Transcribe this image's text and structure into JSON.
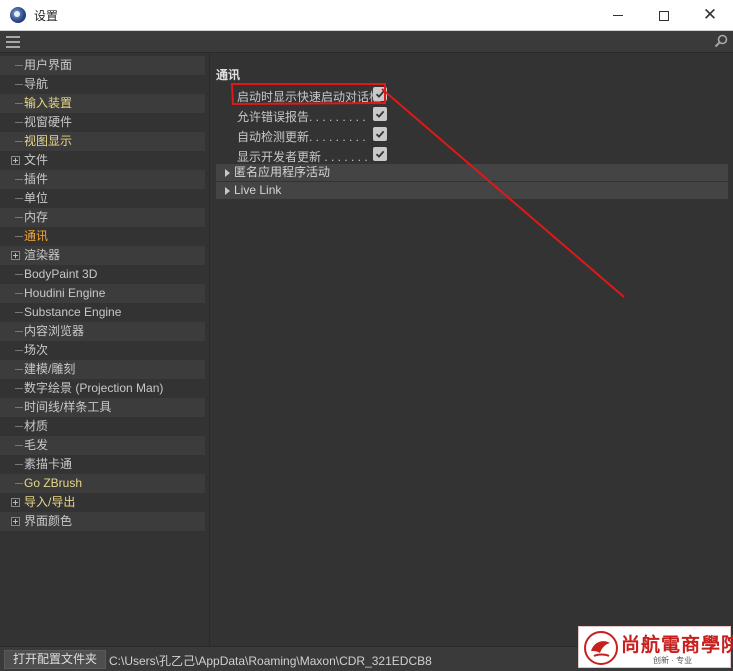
{
  "window": {
    "title": "设置",
    "minimize_icon": "minimize-icon",
    "maximize_icon": "maximize-icon",
    "close_icon": "close-icon"
  },
  "toolbar": {
    "menu_icon": "hamburger-menu-icon",
    "search_icon": "search-icon"
  },
  "sidebar": {
    "items": [
      {
        "label": "用户界面",
        "expandable": false,
        "style": "normal"
      },
      {
        "label": "导航",
        "expandable": false,
        "style": "normal"
      },
      {
        "label": "输入装置",
        "expandable": false,
        "style": "yellow"
      },
      {
        "label": "视窗硬件",
        "expandable": false,
        "style": "normal"
      },
      {
        "label": "视图显示",
        "expandable": false,
        "style": "yellow"
      },
      {
        "label": "文件",
        "expandable": true,
        "style": "normal"
      },
      {
        "label": "插件",
        "expandable": false,
        "style": "normal"
      },
      {
        "label": "单位",
        "expandable": false,
        "style": "normal"
      },
      {
        "label": "内存",
        "expandable": false,
        "style": "normal"
      },
      {
        "label": "通讯",
        "expandable": false,
        "style": "selected"
      },
      {
        "label": "渲染器",
        "expandable": true,
        "style": "normal"
      },
      {
        "label": "BodyPaint 3D",
        "expandable": false,
        "style": "normal"
      },
      {
        "label": "Houdini Engine",
        "expandable": false,
        "style": "normal"
      },
      {
        "label": "Substance Engine",
        "expandable": false,
        "style": "normal"
      },
      {
        "label": "内容浏览器",
        "expandable": false,
        "style": "normal"
      },
      {
        "label": "场次",
        "expandable": false,
        "style": "normal"
      },
      {
        "label": "建模/雕刻",
        "expandable": false,
        "style": "normal"
      },
      {
        "label": "数字绘景 (Projection Man)",
        "expandable": false,
        "style": "normal"
      },
      {
        "label": "时间线/样条工具",
        "expandable": false,
        "style": "normal"
      },
      {
        "label": "材质",
        "expandable": false,
        "style": "normal"
      },
      {
        "label": "毛发",
        "expandable": false,
        "style": "normal"
      },
      {
        "label": "素描卡通",
        "expandable": false,
        "style": "normal"
      },
      {
        "label": "Go ZBrush",
        "expandable": false,
        "style": "yellow"
      },
      {
        "label": "导入/导出",
        "expandable": true,
        "style": "yellow"
      },
      {
        "label": "界面颜色",
        "expandable": true,
        "style": "normal"
      }
    ]
  },
  "main": {
    "section_title": "通讯",
    "options": [
      {
        "label": "启动时显示快速启动对话框",
        "checked": true
      },
      {
        "label": "允许错误报告. . . . . . . . .",
        "checked": true
      },
      {
        "label": "自动检测更新. . . . . . . . .",
        "checked": true
      },
      {
        "label": "显示开发者更新 . . . . . . .",
        "checked": true
      }
    ],
    "groups": [
      {
        "label": "匿名应用程序活动"
      },
      {
        "label": "Live Link"
      }
    ]
  },
  "footer": {
    "open_button": "打开配置文件夹",
    "path": "C:\\Users\\孔乙己\\AppData\\Roaming\\Maxon\\CDR_321EDCB8"
  },
  "watermark": {
    "text": "尚航電商學院",
    "subtext": "创新 · 专业"
  },
  "colors": {
    "background": "#333333",
    "selected_text": "#f2a33a",
    "highlight_text": "#e6d78a",
    "annotation": "#e01818"
  }
}
